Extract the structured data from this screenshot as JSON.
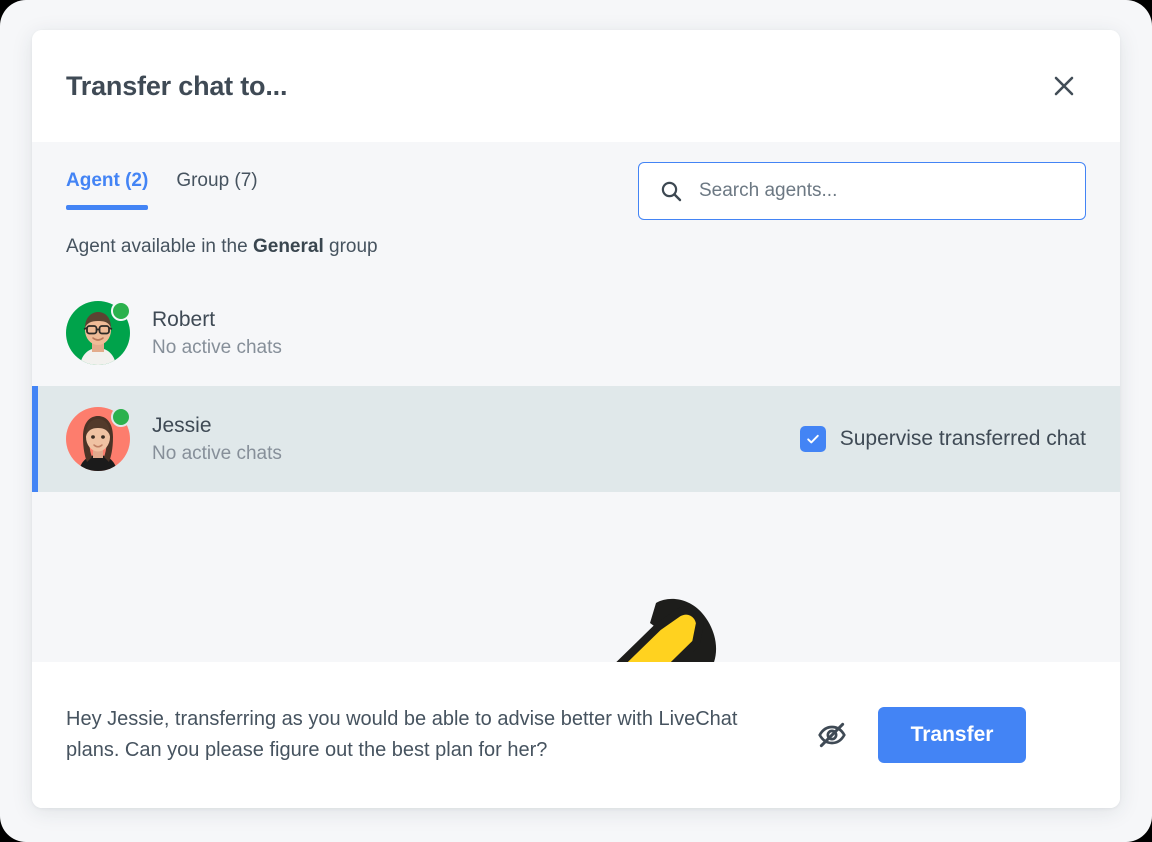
{
  "modal": {
    "title": "Transfer chat to...",
    "close_icon": "close-icon"
  },
  "tabs": [
    {
      "label": "Agent (2)",
      "active": true
    },
    {
      "label": "Group (7)",
      "active": false
    }
  ],
  "search": {
    "placeholder": "Search agents...",
    "value": "",
    "icon": "search-icon"
  },
  "group_note": {
    "prefix": "Agent available in the ",
    "group": "General",
    "suffix": " group"
  },
  "agents": [
    {
      "name": "Robert",
      "status_text": "No active chats",
      "avatar_color": "#00a34b",
      "online": true,
      "selected": false
    },
    {
      "name": "Jessie",
      "status_text": "No active chats",
      "avatar_color": "#fd7d6d",
      "online": true,
      "selected": true
    }
  ],
  "supervise": {
    "label": "Supervise transferred chat",
    "checked": true
  },
  "footer": {
    "message": "Hey Jessie, transferring as you would be able to advise better with LiveChat plans. Can you please figure out the best plan for her?",
    "eye_icon": "eye-off-icon",
    "transfer_label": "Transfer"
  },
  "colors": {
    "accent": "#4384f5",
    "page_bg": "#f6f7f9",
    "card_bg": "#ffffff",
    "selected_row_bg": "#e0e8ea",
    "online_dot": "#2bb14d",
    "text_primary": "#3f4a55",
    "text_muted": "#868f99",
    "hand_yellow": "#ffd21f",
    "hand_outline": "#1d1d1b"
  }
}
